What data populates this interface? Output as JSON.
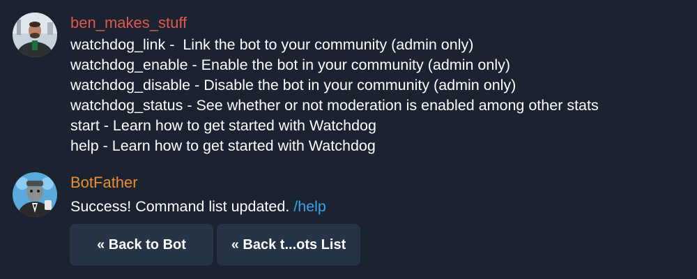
{
  "messages": {
    "ben": {
      "author": "ben_makes_stuff",
      "lines": [
        "watchdog_link -  Link the bot to your community (admin only)",
        "watchdog_enable - Enable the bot in your community (admin only)",
        "watchdog_disable - Disable the bot in your community (admin only)",
        "watchdog_status - See whether or not moderation is enabled among other stats",
        "start - Learn how to get started with Watchdog",
        "help - Learn how to get started with Watchdog"
      ]
    },
    "bot": {
      "author": "BotFather",
      "text": "Success! Command list updated. ",
      "link": "/help"
    }
  },
  "buttons": {
    "back_to_bot": "« Back to Bot",
    "back_to_bots_list": "« Back t...ots List"
  },
  "colors": {
    "background": "#1b2230",
    "author_ben": "#e0594d",
    "author_bot": "#e98e32",
    "link": "#3ea0e8",
    "button_bg": "#273447"
  }
}
